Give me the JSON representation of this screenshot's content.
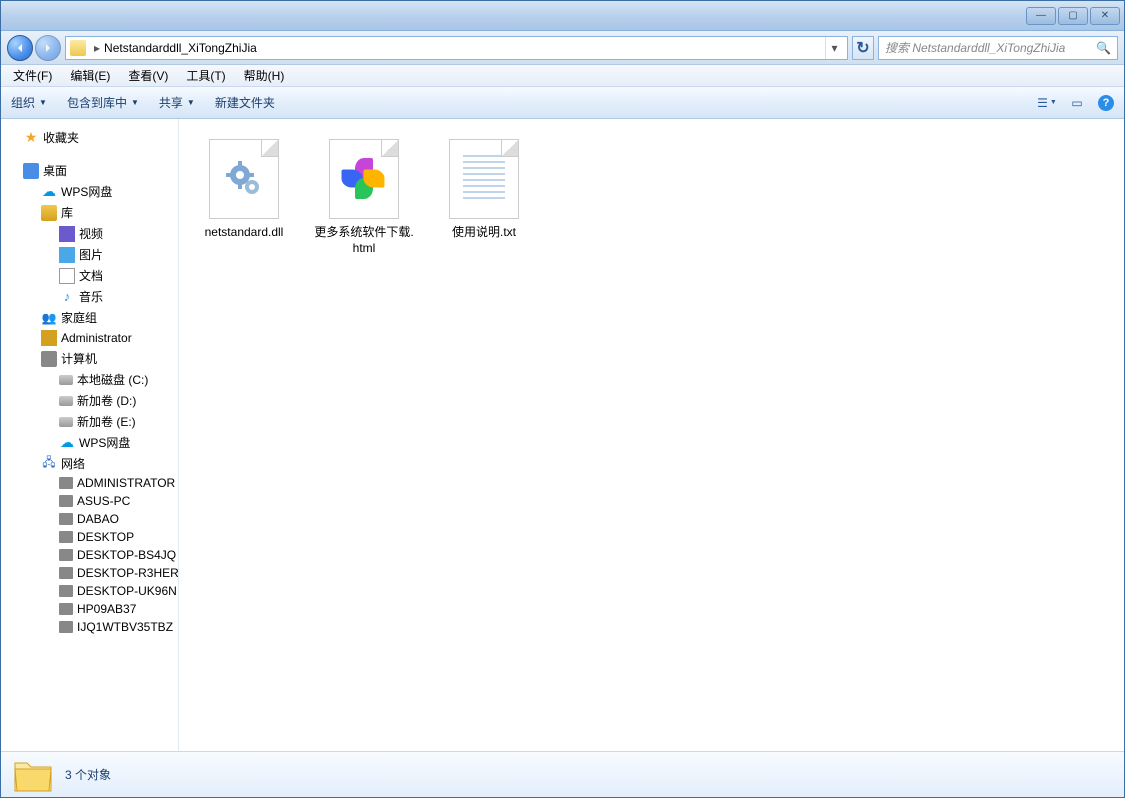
{
  "titlebar": {
    "min": "—",
    "max": "▢",
    "close": "✕"
  },
  "nav": {
    "path_label": "Netstandarddll_XiTongZhiJia",
    "refresh": "↻",
    "dropdown": "▾"
  },
  "search": {
    "placeholder": "搜索 Netstandarddll_XiTongZhiJia",
    "icon": "🔍"
  },
  "menubar": {
    "file": "文件(F)",
    "edit": "编辑(E)",
    "view": "查看(V)",
    "tools": "工具(T)",
    "help": "帮助(H)"
  },
  "toolbar": {
    "organize": "组织",
    "include": "包含到库中",
    "share": "共享",
    "newfolder": "新建文件夹",
    "views": "☰",
    "preview": "▭",
    "help": "?"
  },
  "sidebar": {
    "favorites": "收藏夹",
    "desktop": "桌面",
    "wps": "WPS网盘",
    "libraries": "库",
    "videos": "视频",
    "pictures": "图片",
    "documents": "文档",
    "music": "音乐",
    "homegroup": "家庭组",
    "admin": "Administrator",
    "computer": "计算机",
    "drive_c": "本地磁盘 (C:)",
    "drive_d": "新加卷 (D:)",
    "drive_e": "新加卷 (E:)",
    "wps2": "WPS网盘",
    "network": "网络",
    "net_items": [
      "ADMINISTRATOR",
      "ASUS-PC",
      "DABAO",
      "DESKTOP",
      "DESKTOP-BS4JQ",
      "DESKTOP-R3HER",
      "DESKTOP-UK96N",
      "HP09AB37",
      "IJQ1WTBV35TBZ"
    ]
  },
  "files": [
    {
      "name": "netstandard.dll",
      "type": "dll"
    },
    {
      "name": "更多系统软件下载.html",
      "type": "html"
    },
    {
      "name": "使用说明.txt",
      "type": "txt"
    }
  ],
  "status": {
    "text": "3 个对象"
  }
}
